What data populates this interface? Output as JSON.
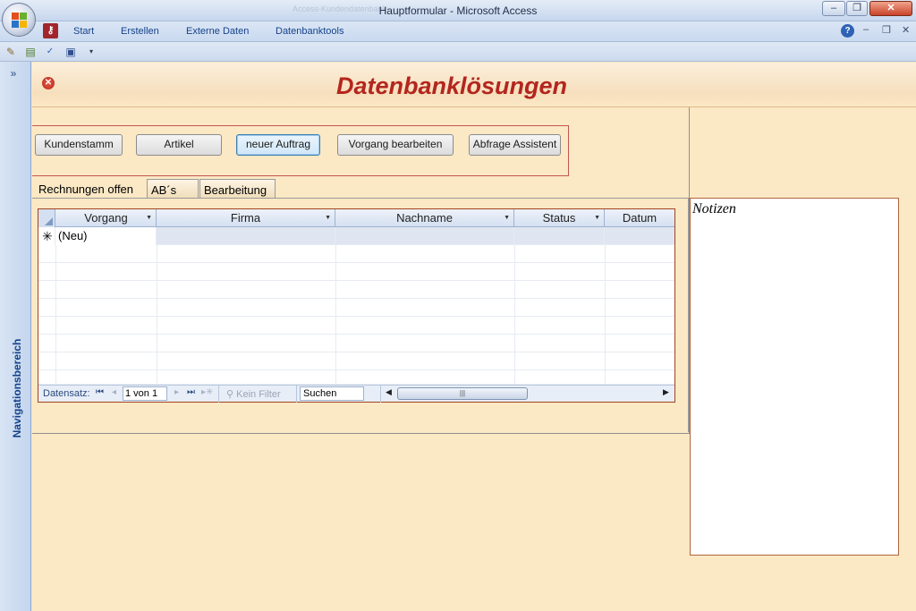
{
  "window": {
    "title": "Hauptformular - Microsoft Access",
    "ghost_title": "Access-Kundendatenbank",
    "minimize": "–",
    "restore": "❐",
    "close": "✕"
  },
  "menubar": {
    "items": [
      "Start",
      "Erstellen",
      "Externe Daten",
      "Datenbanktools"
    ],
    "help": "?",
    "mdi_minimize": "–",
    "mdi_restore": "❐",
    "mdi_close": "✕"
  },
  "quick_access": {
    "icons": [
      "tools-icon",
      "database-icon",
      "spellcheck-icon",
      "save-icon",
      "customize-dropdown-icon"
    ]
  },
  "nav_pane": {
    "expand": "»",
    "label": "Navigationsbereich"
  },
  "form": {
    "title": "Datenbanklösungen",
    "close": "✕",
    "buttons": [
      "Kundenstamm",
      "Artikel",
      "neuer Auftrag",
      "Vorgang bearbeiten",
      "Abfrage Assistent"
    ],
    "tabs": [
      "Rechnungen offen",
      "AB´s",
      "Bearbeitung"
    ],
    "active_tab": "Rechnungen offen"
  },
  "datasheet": {
    "columns": [
      "Vorgang",
      "Firma",
      "Nachname",
      "Status",
      "Datum"
    ],
    "new_row_marker": "✳",
    "new_row_label": "(Neu)",
    "navigation": {
      "label": "Datensatz:",
      "first": "⏮",
      "prev": "◂",
      "next": "▸",
      "last": "⏭",
      "new": "▸✳",
      "record": "1 von 1",
      "filter": "Kein Filter",
      "search": "Suchen",
      "scroll_left": "◀",
      "scroll_right": "▶",
      "scroll_grip": "|||"
    }
  },
  "notes": {
    "label": "Notizen"
  },
  "colors": {
    "form_background": "#fbe8c4",
    "title_color": "#b3261e",
    "ribbon_blue": "#15428b"
  }
}
